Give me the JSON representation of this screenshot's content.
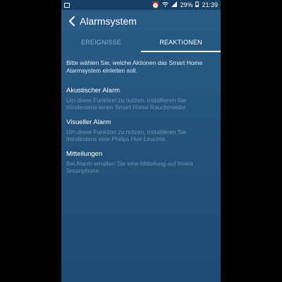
{
  "statusbar": {
    "battery": "29%",
    "time": "21:39"
  },
  "header": {
    "title": "Alarmsystem"
  },
  "tabs": [
    {
      "label": "EREIGNISSE",
      "active": false
    },
    {
      "label": "REAKTIONEN",
      "active": true
    }
  ],
  "intro": "Bitte wählen Sie, welche Aktionen das Smart Home Alarmsystem einleiten soll.",
  "sections": [
    {
      "title": "Akustischer Alarm",
      "description": "Um diese Funktion zu nutzen, installieren Sie mindestens einen Smart Home Rauchmelder."
    },
    {
      "title": "Visueller Alarm",
      "description": "Um diese Funktion zu nutzen, installieren Sie mindestens eine Philips Hue Leuchte."
    },
    {
      "title": "Mitteilungen",
      "description": "Bei Alarm erhalten Sie eine Mitteilung auf Ihrem Smartphone."
    }
  ],
  "colors": {
    "background": "#24557e",
    "statusbar": "#173f63",
    "active_tab": "#ffffff",
    "inactive_tab": "#8fb2cf",
    "muted_text": "#6f92b2"
  }
}
